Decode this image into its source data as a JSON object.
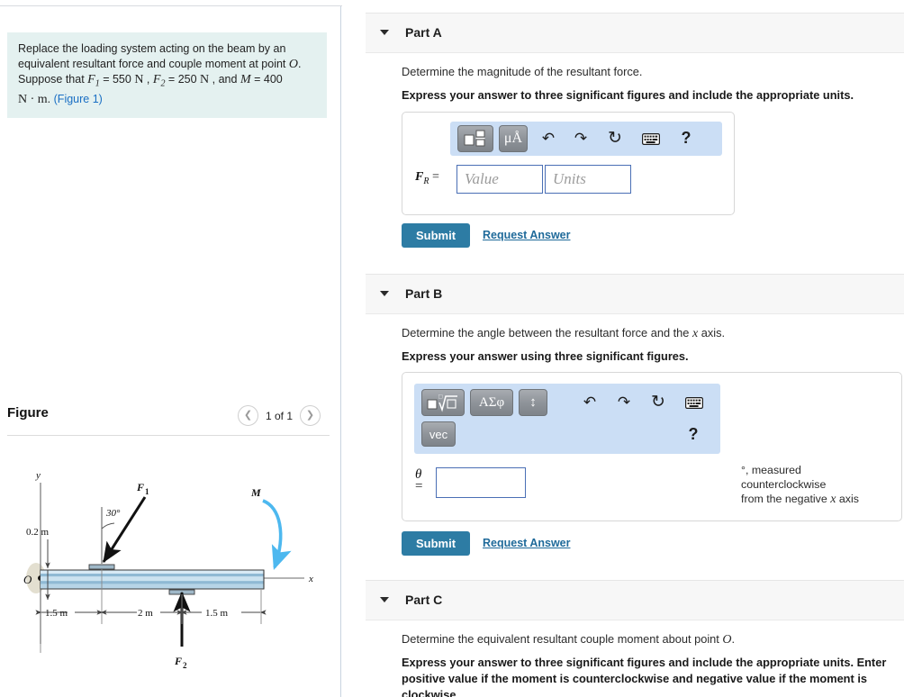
{
  "problem": {
    "line1": "Replace the loading system acting on the beam by an",
    "line2_a": "equivalent resultant force and couple moment at point",
    "line2_point": "O",
    "line3_suppose": "Suppose that",
    "f1_sym": "F",
    "f1_sub": "1",
    "f1_eq": "= 550",
    "f1_unit": "N",
    "f2_sym": "F",
    "f2_sub": "2",
    "f2_eq": "= 250",
    "f2_unit": "N",
    "and": ", and",
    "m_sym": "M",
    "m_eq": "= 400",
    "m_unit": "N · m",
    "figure_link": "(Figure 1)"
  },
  "figure_panel": {
    "title": "Figure",
    "prev_icon": "chevron-left-icon",
    "next_icon": "chevron-right-icon",
    "counter": "1 of 1"
  },
  "diagram": {
    "origin_label": "O",
    "y_axis_label": "y",
    "x_axis_label": "x",
    "f1_label": "F",
    "f1_sub": "1",
    "f2_label": "F",
    "f2_sub": "2",
    "moment_label": "M",
    "angle_label": "30°",
    "offset_label": "0.2 m",
    "dim1": "1.5 m",
    "dim2": "2 m",
    "dim3": "1.5 m",
    "beam_color": "#a9cde4",
    "moment_arrow_color": "#4db8ef"
  },
  "parts": [
    {
      "id": "a",
      "caret_icon": "caret-down-icon",
      "label": "Part A",
      "question": "Determine the magnitude of the resultant force.",
      "instruction": "Express your answer to three significant figures and include the appropriate units.",
      "toolbar": {
        "buttons": [
          "template-icon",
          "units-icon"
        ],
        "icons": [
          "undo-icon",
          "redo-icon",
          "reset-icon",
          "keyboard-icon",
          "help-icon"
        ],
        "button_labels": [
          "■",
          "μÅ"
        ],
        "help_label": "?"
      },
      "answer": {
        "prefix_sym": "F",
        "prefix_sub": "R",
        "prefix_eq": "=",
        "value_placeholder": "Value",
        "units_placeholder": "Units",
        "value": "",
        "units": ""
      },
      "submit_label": "Submit",
      "request_label": "Request Answer"
    },
    {
      "id": "b",
      "caret_icon": "caret-down-icon",
      "label": "Part B",
      "question_pre": "Determine the angle between the resultant force and the",
      "question_var": "x",
      "question_post": "axis.",
      "instruction": "Express your answer using three significant figures.",
      "toolbar": {
        "button_labels": [
          "■√□",
          "ΑΣφ",
          "↕",
          "vec"
        ],
        "icons": [
          "undo-icon",
          "redo-icon",
          "reset-icon",
          "keyboard-icon",
          "help-icon"
        ],
        "help_label": "?"
      },
      "answer": {
        "theta_sym": "θ",
        "theta_eq": "=",
        "value": ""
      },
      "note_line1": "°, measured",
      "note_line2": "counterclockwise",
      "note_line3_pre": "from the negative",
      "note_line3_var": "x",
      "note_line3_post": "axis",
      "submit_label": "Submit",
      "request_label": "Request Answer"
    },
    {
      "id": "c",
      "caret_icon": "caret-down-icon",
      "label": "Part C",
      "question_pre": "Determine the equivalent resultant couple moment about point",
      "question_var": "O",
      "question_post": ".",
      "instruction_l1": "Express your answer to three significant figures and include the appropriate units. Enter",
      "instruction_l2": "positive value if the moment is counterclockwise and negative value if the moment is",
      "instruction_l3": "clockwise."
    }
  ],
  "colors": {
    "accent": "#2d7ca4",
    "link": "#1f6a9a",
    "problem_bg": "#e4f1f0",
    "toolbar_bg": "#cbdef5",
    "input_border": "#4a6fb5"
  }
}
